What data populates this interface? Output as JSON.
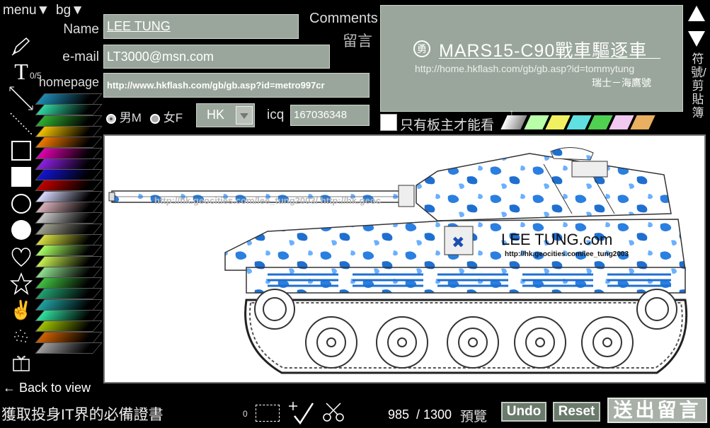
{
  "top_menu": {
    "menu_label": "menu▼",
    "bg_label": "bg▼"
  },
  "form": {
    "name_label": "Name",
    "name_value": "LEE TUNG",
    "email_label": "e-mail",
    "email_value": "LT3000@msn.com",
    "homepage_label": "homepage",
    "homepage_value": "http://www.hkflash.com/gb/gb.asp?id=metro997cr",
    "gender_male": "男M",
    "gender_female": "女F",
    "region_value": "HK",
    "icq_label": "icq",
    "icq_value": "167036348",
    "comments_label": "Comments",
    "comments_label_cn": "留言",
    "private_label": "只有板主才能看"
  },
  "preview": {
    "seal_glyph": "勇",
    "title": "MARS15-C90戰車驅逐車",
    "url": "http://home.hkflash.com/gb/gb.asp?id=tommytung",
    "sign": "瑞士－海鷹號"
  },
  "side_panel": {
    "text": "符號/剪貼簿"
  },
  "toolbar": {
    "text_count": "0/5"
  },
  "palette": {
    "colors": [
      "#1f8ab3",
      "#2fd6a2",
      "#2fae2f",
      "#f2c200",
      "#f07800",
      "#e000b0",
      "#8c1fe0",
      "#1414d0",
      "#c00000",
      "#d9d9ff",
      "#d8b0b8",
      "#c8c8c8",
      "#a0a090",
      "#d8e040",
      "#a8ff60",
      "#c8f050",
      "#90e090",
      "#40c040",
      "#20a070",
      "#20a0a0",
      "#30e0a0",
      "#a0c000",
      "#d06000",
      "#a0a0a0"
    ],
    "tint_colors": [
      "#b8ffa8",
      "#f0f060",
      "#60e0e0",
      "#50d050",
      "#f0c8f0",
      "#e8b060"
    ]
  },
  "canvas": {
    "watermark_url": "http://hk.geocities.com/lee_tung2003/ http://hk.geoc",
    "plate_text": "LEE TUNG.com",
    "plate_url": "http://hk.geocities.com/lee_tung2003"
  },
  "footer": {
    "back_label": "← Back to view",
    "slogan": "獲取投身IT界的必備證書",
    "zero": "0",
    "counter": "985",
    "counter_max": "/ 1300",
    "preview_label": "預覽",
    "undo_label": "Undo",
    "reset_label": "Reset",
    "send_label": "送出留言"
  }
}
